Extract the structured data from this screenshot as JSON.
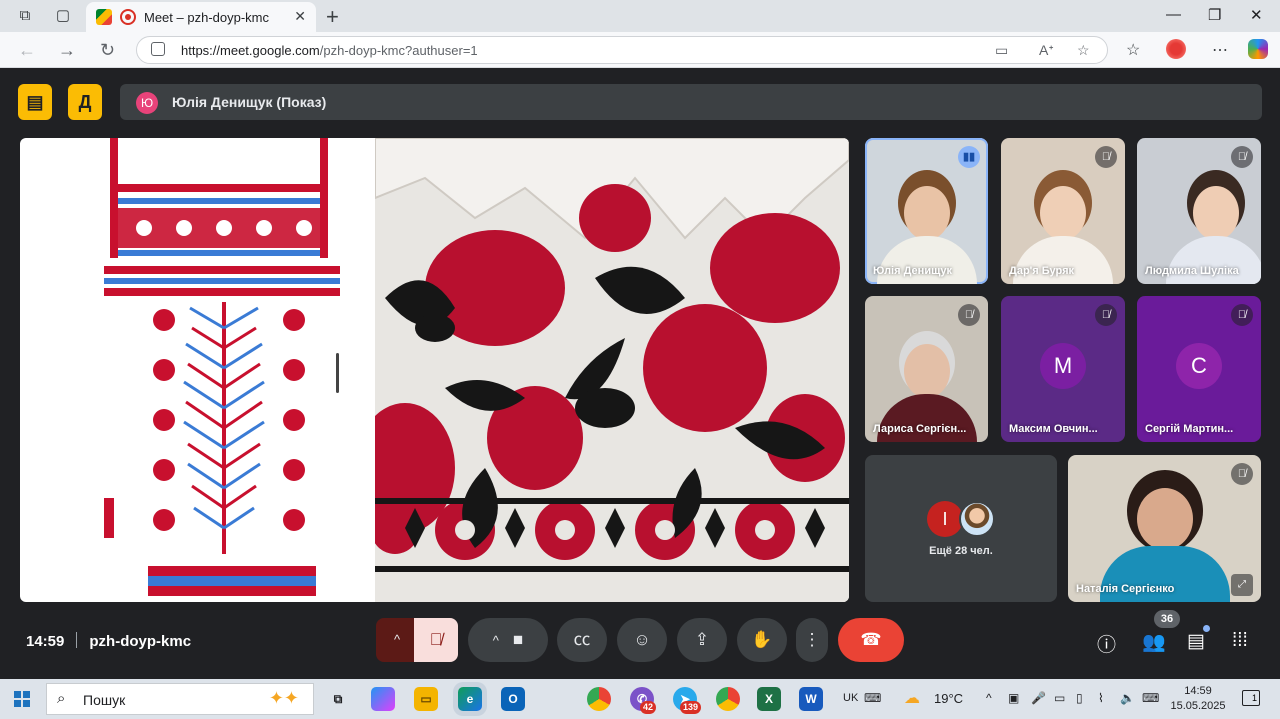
{
  "browser": {
    "tab_title": "Meet – pzh-doyp-kmc",
    "url_host": "https://meet.google.com",
    "url_path": "/pzh-doyp-kmc?authuser=1"
  },
  "meeting": {
    "presenter_initial": "Ю",
    "presenter_label": "Юлія Денищук (Показ)",
    "time": "14:59",
    "code": "pzh-doyp-kmc",
    "people_count": "36",
    "more_label": "Ещё 28 чел.",
    "more_avatar_initial": "І"
  },
  "participants": [
    {
      "name": "Юлія Денищук",
      "status": "speaking"
    },
    {
      "name": "Дар'я Буряк",
      "status": "muted"
    },
    {
      "name": "Людмила Шуліка",
      "status": "muted"
    },
    {
      "name": "Лариса Сергієн...",
      "status": "muted"
    },
    {
      "name": "Максим Овчин...",
      "initial": "М",
      "status": "muted"
    },
    {
      "name": "Сергій Мартин...",
      "initial": "С",
      "status": "muted"
    },
    {
      "name": "Наталія Сергієнко",
      "status": "muted"
    }
  ],
  "taskbar": {
    "search_placeholder": "Пошук",
    "lang": "UK",
    "temperature": "19°C",
    "time": "14:59",
    "date": "15.05.2025",
    "notifications": "1",
    "badges": {
      "viber": "42",
      "telegram": "139"
    }
  },
  "colors": {
    "accent_yellow": "#fbbc04",
    "leave_red": "#ea4335",
    "avatar_purple": "#7b1fa2",
    "embroidery_red": "#c8102e"
  }
}
